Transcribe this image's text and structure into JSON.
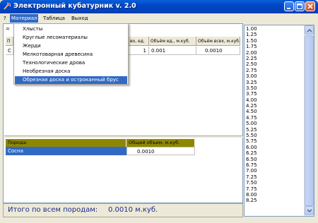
{
  "window": {
    "title": "Электронный кубатурник v. 2.0"
  },
  "menubar": {
    "items": [
      "?",
      "Материал",
      "Таблица",
      "Выход"
    ]
  },
  "dropdown": {
    "items": [
      "Хлысты",
      "Круглые лесоматериалы",
      "Жерди",
      "Мелкотоварная древесина",
      "Технологические дрова",
      "Необрезная доска",
      "Обрезная доска и остроканный брус"
    ],
    "highlighted_index": 6
  },
  "toolbar": {
    "glyph": "="
  },
  "grid1": {
    "headers": [
      "П",
      "во, ед.",
      "Объём ед., м.куб.",
      "Объём всех, м.куб."
    ],
    "row": [
      "С",
      "1",
      "0.001",
      "0.0010"
    ]
  },
  "grid2": {
    "headers": [
      "Порода:",
      "Общий объем, м.куб."
    ],
    "row": [
      "Сосна",
      "0.0010"
    ]
  },
  "footer": {
    "label": "Итого по всем породам:",
    "value": "0.0010 м.куб."
  },
  "length_list": {
    "items": [
      "1.00",
      "1.25",
      "1.50",
      "1.75",
      "2.00",
      "2.25",
      "2.50",
      "2.75",
      "3.00",
      "3.25",
      "3.50",
      "3.75",
      "4.00",
      "4.25",
      "4.50",
      "4.75",
      "5.00",
      "5.25",
      "5.50",
      "5.75",
      "6.00",
      "6.25",
      "6.50",
      "6.75",
      "7.00",
      "7.25",
      "7.50",
      "7.75",
      "8.00",
      "8.25"
    ]
  },
  "colors": {
    "titlebar": "#0046c6",
    "highlight": "#316ac5",
    "grid2_header": "#8f8600",
    "footer_text": "#1e2d8a"
  },
  "icons": {
    "app": "axe-icon",
    "minimize": "minimize-icon",
    "maximize": "maximize-icon",
    "close": "close-icon"
  }
}
